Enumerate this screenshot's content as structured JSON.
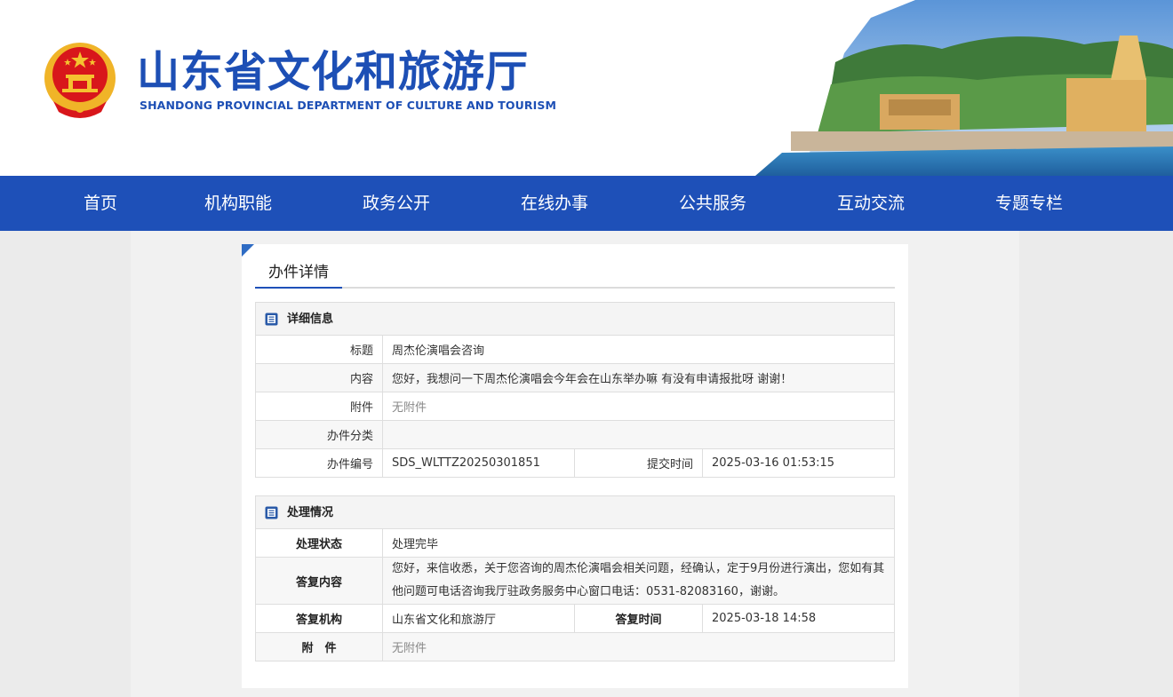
{
  "header": {
    "title_cn": "山东省文化和旅游厅",
    "title_en": "SHANDONG PROVINCIAL DEPARTMENT OF CULTURE AND  TOURISM"
  },
  "nav": {
    "items": [
      {
        "label": "首页"
      },
      {
        "label": "机构职能"
      },
      {
        "label": "政务公开"
      },
      {
        "label": "在线办事"
      },
      {
        "label": "公共服务"
      },
      {
        "label": "互动交流"
      },
      {
        "label": "专题专栏"
      }
    ]
  },
  "card": {
    "title": "办件详情"
  },
  "detail": {
    "heading": "详细信息",
    "title_label": "标题",
    "title_value": "周杰伦演唱会咨询",
    "content_label": "内容",
    "content_value": "您好，我想问一下周杰伦演唱会今年会在山东举办嘛 有没有申请报批呀 谢谢！",
    "attachment_label": "附件",
    "attachment_value": "无附件",
    "category_label": "办件分类",
    "category_value": "",
    "number_label": "办件编号",
    "number_value": "SDS_WLTTZ20250301851",
    "submit_time_label": "提交时间",
    "submit_time_value": "2025-03-16 01:53:15"
  },
  "handling": {
    "heading": "处理情况",
    "status_label": "处理状态",
    "status_value": "处理完毕",
    "reply_label": "答复内容",
    "reply_value": "您好，来信收悉，关于您咨询的周杰伦演唱会相关问题，经确认，定于9月份进行演出，您如有其他问题可电话咨询我厅驻政务服务中心窗口电话：0531-82083160，谢谢。",
    "org_label": "答复机构",
    "org_value": "山东省文化和旅游厅",
    "reply_time_label": "答复时间",
    "reply_time_value": "2025-03-18 14:58",
    "attachment_label": "附　件",
    "attachment_value": "无附件"
  },
  "colors": {
    "brand_blue": "#1e50b8",
    "emblem_red": "#d8161b",
    "emblem_gold": "#f0b428"
  }
}
